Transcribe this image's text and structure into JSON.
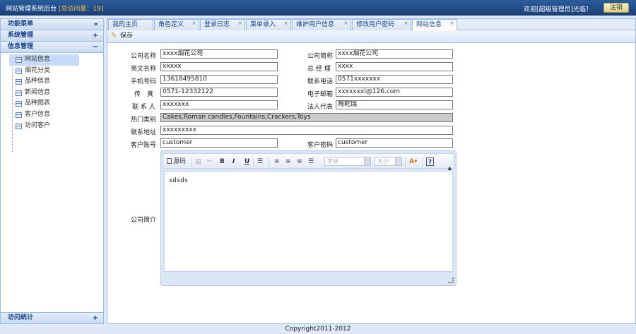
{
  "header": {
    "title": "网站管理系统后台",
    "visit_count": "[总访问量：19]",
    "welcome": "欢迎[超级管理员]光临！",
    "logout_label": "注销"
  },
  "sidebar": {
    "panel_title": "功能菜单",
    "collapse_icon": "«",
    "sections": [
      {
        "label": "系统管理",
        "toggle": "+"
      },
      {
        "label": "信息管理",
        "toggle": "−"
      }
    ],
    "items": [
      "网站信息",
      "烟花分类",
      "品种信息",
      "新闻信息",
      "品种图表",
      "客户信息",
      "访问客户"
    ],
    "bottom_section": {
      "label": "访问统计",
      "toggle": "+"
    }
  },
  "tabs": [
    "我的主页",
    "角色定义",
    "登录日志",
    "菜单录入",
    "维护用户信息",
    "修改用户密码",
    "网站信息"
  ],
  "active_tab": "网站信息",
  "toolbar": {
    "save_label": "保存"
  },
  "form": {
    "company_name_label": "公司名称",
    "company_name": "xxxx烟花公司",
    "company_short_label": "公司简称",
    "company_short": "xxxx烟花公司",
    "english_name_label": "英文名称",
    "english_name": "xxxxx",
    "general_manager_label": "总 经 理",
    "general_manager": "xxxx",
    "mobile_label": "手机号码",
    "mobile": "13618495810",
    "phone_label": "联系电话",
    "phone": "0571xxxxxxx",
    "fax_label": "传　真",
    "fax": "0571-12332122",
    "email_label": "电子邮箱",
    "email": "xxxxxxxl@126.com",
    "contact_label": "联 系 人",
    "contact": "xxxxxxx",
    "legal_rep_label": "法人代表",
    "legal_rep": "陶乾瑞",
    "hot_category_label": "热门类别",
    "hot_category": "Cakes,Roman candles,Fountains,Crackers,Toys",
    "address_label": "联系地址",
    "address": "xxxxxxxxx",
    "account_label": "客户账号",
    "account": "customer",
    "password_label": "客户密码",
    "password": "customer",
    "intro_label": "公司简介"
  },
  "editor": {
    "source_label": "源码",
    "font_combo": "字体",
    "size_combo": "大小",
    "help_label": "?",
    "content": "sdsds"
  },
  "footer": {
    "copyright": "Copyright2011-2012"
  }
}
